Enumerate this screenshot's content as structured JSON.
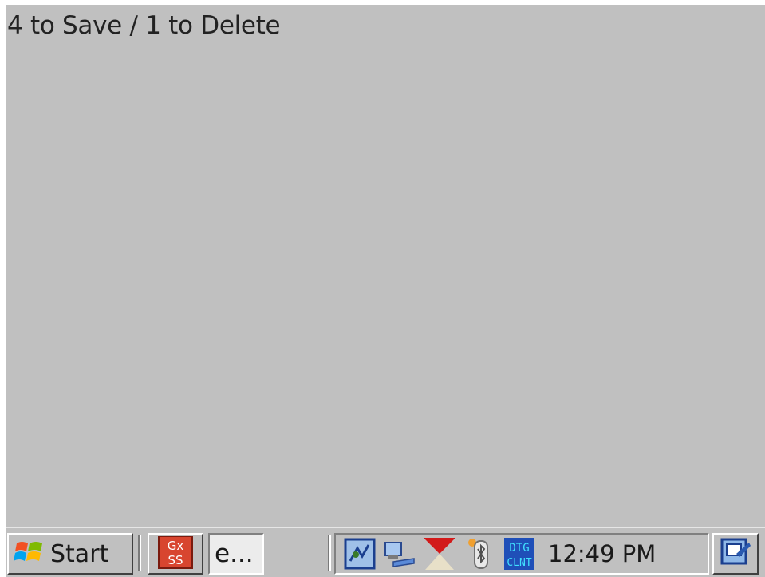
{
  "app": {
    "prompt": "4 to Save / 1 to Delete"
  },
  "taskbar": {
    "start_label": "Start",
    "tasks": [
      {
        "icon": "gxss-app-icon",
        "label": ""
      },
      {
        "icon": "",
        "label": "e..."
      }
    ],
    "tray_icons": [
      "network-connection-icon",
      "activesync-computer-icon",
      "signal-strength-icon",
      "bluetooth-icon",
      "dtg-client-icon"
    ],
    "clock": "12:49 PM",
    "desktop_icon": "show-desktop-icon"
  },
  "colors": {
    "background": "#c0c0c0",
    "taskbar": "#c0c0c0",
    "text": "#222222"
  }
}
